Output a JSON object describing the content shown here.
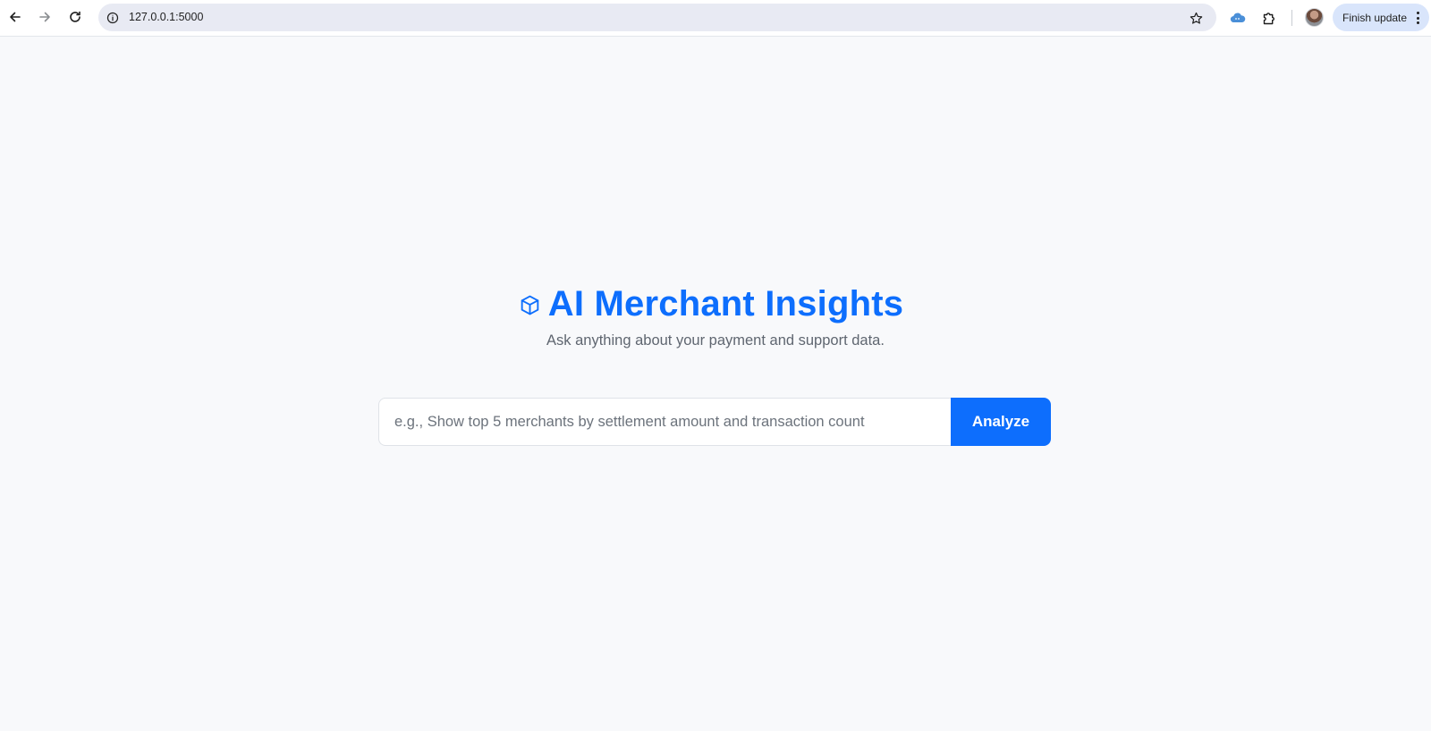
{
  "browser": {
    "url": "127.0.0.1:5000",
    "finish_update_label": "Finish update",
    "icons": {
      "back": "arrow-left-icon",
      "forward": "arrow-right-icon",
      "reload": "reload-icon",
      "site_info": "info-icon",
      "bookmark": "star-icon",
      "extension": "cloud-icon",
      "extensions_menu": "puzzle-icon",
      "menu": "kebab-menu-icon"
    }
  },
  "page": {
    "title": "AI Merchant Insights",
    "title_icon": "cube-icon",
    "subtitle": "Ask anything about your payment and support data.",
    "search": {
      "placeholder": "e.g., Show top 5 merchants by settlement amount and transaction count",
      "value": "",
      "button_label": "Analyze"
    }
  },
  "colors": {
    "accent": "#0d6efd",
    "page_background": "#f8f9fb",
    "subtitle": "#5f6670",
    "omnibox": "#e8eaf3",
    "update_chip": "#d9e5fb"
  }
}
